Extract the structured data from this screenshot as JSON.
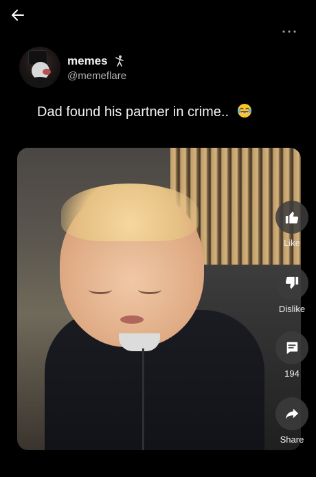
{
  "top_bar": {
    "back_icon": "arrow-left-icon",
    "more_icon": "more-horizontal-icon"
  },
  "post": {
    "author_name": "memes",
    "author_badge_icon": "dancing-figure-icon",
    "author_handle": "@memeflare",
    "caption": "Dad found his partner in crime..",
    "caption_emoji_icon": "laughing-tears-emoji-icon"
  },
  "video": {
    "thumbnail_description_icon": "video-thumbnail"
  },
  "actions": {
    "like_label": "Like",
    "like_icon": "thumbs-up-icon",
    "dislike_label": "Dislike",
    "dislike_icon": "thumbs-down-icon",
    "comments_count": "194",
    "comments_icon": "comment-icon",
    "share_label": "Share",
    "share_icon": "share-arrow-icon"
  },
  "colors": {
    "background": "#000000",
    "text_primary": "#f2f2f2",
    "text_secondary": "#b3b3b3",
    "action_circle": "#3c3c3c"
  }
}
